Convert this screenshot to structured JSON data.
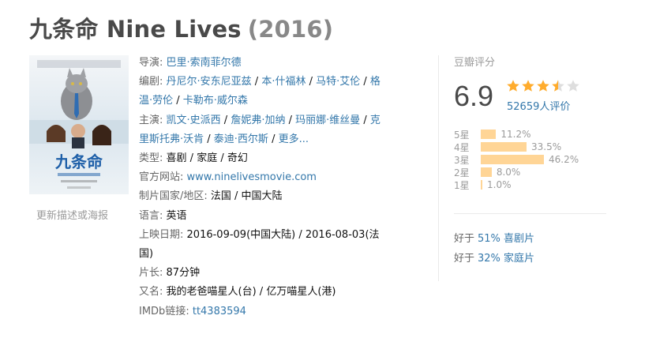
{
  "title": {
    "name": "九条命 Nine Lives",
    "year": "(2016)"
  },
  "poster": {
    "title_text": "九条命",
    "update_link": "更新描述或海报"
  },
  "info": {
    "director_label": "导演:",
    "director": "巴里·索南菲尔德",
    "writer_label": "编剧:",
    "writers": [
      "丹尼尔·安东尼亚兹",
      "本·什福林",
      "马特·艾伦",
      "格温·劳伦",
      "卡勒布·威尔森"
    ],
    "cast_label": "主演:",
    "cast": [
      "凯文·史派西",
      "詹妮弗·加纳",
      "玛丽娜·维丝曼",
      "克里斯托弗·沃肯",
      "泰迪·西尔斯"
    ],
    "cast_more": "更多...",
    "genre_label": "类型:",
    "genres": [
      "喜剧",
      "家庭",
      "奇幻"
    ],
    "website_label": "官方网站:",
    "website": "www.ninelivesmovie.com",
    "country_label": "制片国家/地区:",
    "country": "法国 / 中国大陆",
    "language_label": "语言:",
    "language": "英语",
    "release_label": "上映日期:",
    "release_dates": [
      "2016-09-09(中国大陆)",
      "2016-08-03(法国)"
    ],
    "runtime_label": "片长:",
    "runtime": "87分钟",
    "aka_label": "又名:",
    "aka": "我的老爸喵星人(台) / 亿万喵星人(港)",
    "imdb_label": "IMDb链接:",
    "imdb": "tt4383594"
  },
  "rating": {
    "label": "豆瓣评分",
    "score": "6.9",
    "stars": 3.5,
    "votes": "52659人评价",
    "distribution": [
      {
        "label": "5星",
        "percent": 11.2,
        "text": "11.2%"
      },
      {
        "label": "4星",
        "percent": 33.5,
        "text": "33.5%"
      },
      {
        "label": "3星",
        "percent": 46.2,
        "text": "46.2%"
      },
      {
        "label": "2星",
        "percent": 8.0,
        "text": "8.0%"
      },
      {
        "label": "1星",
        "percent": 1.0,
        "text": "1.0%"
      }
    ],
    "better_than": [
      {
        "prefix": "好于",
        "text": "51% 喜剧片"
      },
      {
        "prefix": "好于",
        "text": "32% 家庭片"
      }
    ]
  },
  "colors": {
    "link": "#3377aa",
    "star": "#ffac2d",
    "bar": "#ffd596",
    "title": "#494949"
  }
}
